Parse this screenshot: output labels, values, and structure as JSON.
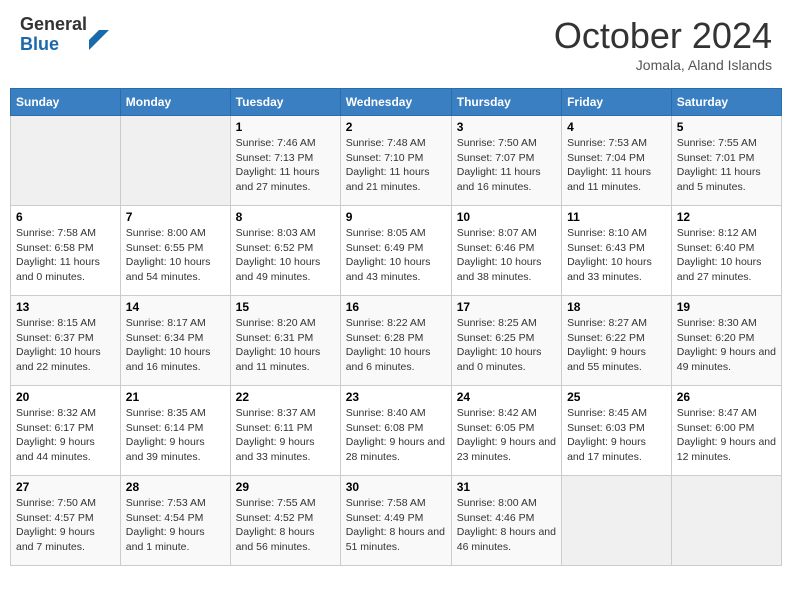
{
  "header": {
    "logo_general": "General",
    "logo_blue": "Blue",
    "month_title": "October 2024",
    "location": "Jomala, Aland Islands"
  },
  "weekdays": [
    "Sunday",
    "Monday",
    "Tuesday",
    "Wednesday",
    "Thursday",
    "Friday",
    "Saturday"
  ],
  "weeks": [
    [
      {
        "day": "",
        "sunrise": "",
        "sunset": "",
        "daylight": ""
      },
      {
        "day": "",
        "sunrise": "",
        "sunset": "",
        "daylight": ""
      },
      {
        "day": "1",
        "sunrise": "Sunrise: 7:46 AM",
        "sunset": "Sunset: 7:13 PM",
        "daylight": "Daylight: 11 hours and 27 minutes."
      },
      {
        "day": "2",
        "sunrise": "Sunrise: 7:48 AM",
        "sunset": "Sunset: 7:10 PM",
        "daylight": "Daylight: 11 hours and 21 minutes."
      },
      {
        "day": "3",
        "sunrise": "Sunrise: 7:50 AM",
        "sunset": "Sunset: 7:07 PM",
        "daylight": "Daylight: 11 hours and 16 minutes."
      },
      {
        "day": "4",
        "sunrise": "Sunrise: 7:53 AM",
        "sunset": "Sunset: 7:04 PM",
        "daylight": "Daylight: 11 hours and 11 minutes."
      },
      {
        "day": "5",
        "sunrise": "Sunrise: 7:55 AM",
        "sunset": "Sunset: 7:01 PM",
        "daylight": "Daylight: 11 hours and 5 minutes."
      }
    ],
    [
      {
        "day": "6",
        "sunrise": "Sunrise: 7:58 AM",
        "sunset": "Sunset: 6:58 PM",
        "daylight": "Daylight: 11 hours and 0 minutes."
      },
      {
        "day": "7",
        "sunrise": "Sunrise: 8:00 AM",
        "sunset": "Sunset: 6:55 PM",
        "daylight": "Daylight: 10 hours and 54 minutes."
      },
      {
        "day": "8",
        "sunrise": "Sunrise: 8:03 AM",
        "sunset": "Sunset: 6:52 PM",
        "daylight": "Daylight: 10 hours and 49 minutes."
      },
      {
        "day": "9",
        "sunrise": "Sunrise: 8:05 AM",
        "sunset": "Sunset: 6:49 PM",
        "daylight": "Daylight: 10 hours and 43 minutes."
      },
      {
        "day": "10",
        "sunrise": "Sunrise: 8:07 AM",
        "sunset": "Sunset: 6:46 PM",
        "daylight": "Daylight: 10 hours and 38 minutes."
      },
      {
        "day": "11",
        "sunrise": "Sunrise: 8:10 AM",
        "sunset": "Sunset: 6:43 PM",
        "daylight": "Daylight: 10 hours and 33 minutes."
      },
      {
        "day": "12",
        "sunrise": "Sunrise: 8:12 AM",
        "sunset": "Sunset: 6:40 PM",
        "daylight": "Daylight: 10 hours and 27 minutes."
      }
    ],
    [
      {
        "day": "13",
        "sunrise": "Sunrise: 8:15 AM",
        "sunset": "Sunset: 6:37 PM",
        "daylight": "Daylight: 10 hours and 22 minutes."
      },
      {
        "day": "14",
        "sunrise": "Sunrise: 8:17 AM",
        "sunset": "Sunset: 6:34 PM",
        "daylight": "Daylight: 10 hours and 16 minutes."
      },
      {
        "day": "15",
        "sunrise": "Sunrise: 8:20 AM",
        "sunset": "Sunset: 6:31 PM",
        "daylight": "Daylight: 10 hours and 11 minutes."
      },
      {
        "day": "16",
        "sunrise": "Sunrise: 8:22 AM",
        "sunset": "Sunset: 6:28 PM",
        "daylight": "Daylight: 10 hours and 6 minutes."
      },
      {
        "day": "17",
        "sunrise": "Sunrise: 8:25 AM",
        "sunset": "Sunset: 6:25 PM",
        "daylight": "Daylight: 10 hours and 0 minutes."
      },
      {
        "day": "18",
        "sunrise": "Sunrise: 8:27 AM",
        "sunset": "Sunset: 6:22 PM",
        "daylight": "Daylight: 9 hours and 55 minutes."
      },
      {
        "day": "19",
        "sunrise": "Sunrise: 8:30 AM",
        "sunset": "Sunset: 6:20 PM",
        "daylight": "Daylight: 9 hours and 49 minutes."
      }
    ],
    [
      {
        "day": "20",
        "sunrise": "Sunrise: 8:32 AM",
        "sunset": "Sunset: 6:17 PM",
        "daylight": "Daylight: 9 hours and 44 minutes."
      },
      {
        "day": "21",
        "sunrise": "Sunrise: 8:35 AM",
        "sunset": "Sunset: 6:14 PM",
        "daylight": "Daylight: 9 hours and 39 minutes."
      },
      {
        "day": "22",
        "sunrise": "Sunrise: 8:37 AM",
        "sunset": "Sunset: 6:11 PM",
        "daylight": "Daylight: 9 hours and 33 minutes."
      },
      {
        "day": "23",
        "sunrise": "Sunrise: 8:40 AM",
        "sunset": "Sunset: 6:08 PM",
        "daylight": "Daylight: 9 hours and 28 minutes."
      },
      {
        "day": "24",
        "sunrise": "Sunrise: 8:42 AM",
        "sunset": "Sunset: 6:05 PM",
        "daylight": "Daylight: 9 hours and 23 minutes."
      },
      {
        "day": "25",
        "sunrise": "Sunrise: 8:45 AM",
        "sunset": "Sunset: 6:03 PM",
        "daylight": "Daylight: 9 hours and 17 minutes."
      },
      {
        "day": "26",
        "sunrise": "Sunrise: 8:47 AM",
        "sunset": "Sunset: 6:00 PM",
        "daylight": "Daylight: 9 hours and 12 minutes."
      }
    ],
    [
      {
        "day": "27",
        "sunrise": "Sunrise: 7:50 AM",
        "sunset": "Sunset: 4:57 PM",
        "daylight": "Daylight: 9 hours and 7 minutes."
      },
      {
        "day": "28",
        "sunrise": "Sunrise: 7:53 AM",
        "sunset": "Sunset: 4:54 PM",
        "daylight": "Daylight: 9 hours and 1 minute."
      },
      {
        "day": "29",
        "sunrise": "Sunrise: 7:55 AM",
        "sunset": "Sunset: 4:52 PM",
        "daylight": "Daylight: 8 hours and 56 minutes."
      },
      {
        "day": "30",
        "sunrise": "Sunrise: 7:58 AM",
        "sunset": "Sunset: 4:49 PM",
        "daylight": "Daylight: 8 hours and 51 minutes."
      },
      {
        "day": "31",
        "sunrise": "Sunrise: 8:00 AM",
        "sunset": "Sunset: 4:46 PM",
        "daylight": "Daylight: 8 hours and 46 minutes."
      },
      {
        "day": "",
        "sunrise": "",
        "sunset": "",
        "daylight": ""
      },
      {
        "day": "",
        "sunrise": "",
        "sunset": "",
        "daylight": ""
      }
    ]
  ]
}
